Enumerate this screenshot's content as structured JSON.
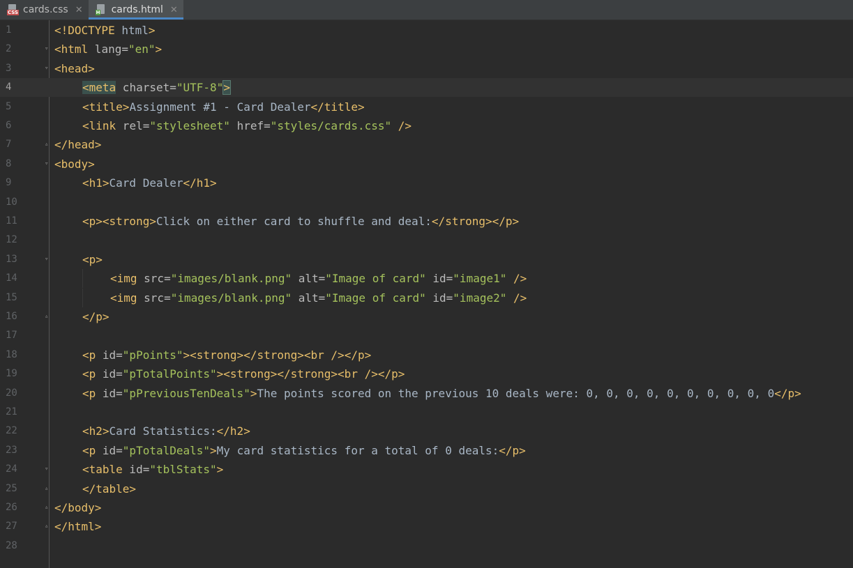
{
  "tabs": [
    {
      "label": "cards.css",
      "type": "css",
      "badge": "CSS",
      "active": false
    },
    {
      "label": "cards.html",
      "type": "html",
      "badge": "H",
      "active": true
    }
  ],
  "colors": {
    "tag": "#e8bf6a",
    "attr": "#bababa",
    "value": "#a5c25c",
    "text": "#a9b7c6",
    "background": "#2b2b2b",
    "accent": "#4a88c7"
  },
  "current_line": 4,
  "lines": [
    {
      "n": "1",
      "indent": 0,
      "fold": "",
      "seg": [
        [
          "tag",
          "<!DOCTYPE"
        ],
        [
          "text",
          " html"
        ],
        [
          "tag",
          ">"
        ]
      ]
    },
    {
      "n": "2",
      "indent": 0,
      "fold": "open",
      "seg": [
        [
          "tag",
          "<html"
        ],
        [
          "attr",
          " lang="
        ],
        [
          "val",
          "\"en\""
        ],
        [
          "tag",
          ">"
        ]
      ]
    },
    {
      "n": "3",
      "indent": 0,
      "fold": "open",
      "seg": [
        [
          "tag",
          "<head>"
        ]
      ]
    },
    {
      "n": "4",
      "indent": 1,
      "fold": "",
      "seg": [
        [
          "taghl",
          "<meta"
        ],
        [
          "attr",
          " charset="
        ],
        [
          "val",
          "\"UTF-8\""
        ],
        [
          "tagcaret",
          ">"
        ]
      ]
    },
    {
      "n": "5",
      "indent": 1,
      "fold": "",
      "seg": [
        [
          "tag",
          "<title>"
        ],
        [
          "text",
          "Assignment #1 - Card Dealer"
        ],
        [
          "tag",
          "</title>"
        ]
      ]
    },
    {
      "n": "6",
      "indent": 1,
      "fold": "",
      "seg": [
        [
          "tag",
          "<link"
        ],
        [
          "attr",
          " rel="
        ],
        [
          "val",
          "\"stylesheet\""
        ],
        [
          "attr",
          " href="
        ],
        [
          "val",
          "\"styles/cards.css\""
        ],
        [
          "tag",
          " />"
        ]
      ]
    },
    {
      "n": "7",
      "indent": 0,
      "fold": "close",
      "seg": [
        [
          "tag",
          "</head>"
        ]
      ]
    },
    {
      "n": "8",
      "indent": 0,
      "fold": "open",
      "seg": [
        [
          "tag",
          "<body>"
        ]
      ]
    },
    {
      "n": "9",
      "indent": 1,
      "fold": "",
      "seg": [
        [
          "tag",
          "<h1>"
        ],
        [
          "text",
          "Card Dealer"
        ],
        [
          "tag",
          "</h1>"
        ]
      ]
    },
    {
      "n": "10",
      "indent": 0,
      "fold": "",
      "seg": []
    },
    {
      "n": "11",
      "indent": 1,
      "fold": "",
      "seg": [
        [
          "tag",
          "<p><strong>"
        ],
        [
          "text",
          "Click on either card to shuffle and deal:"
        ],
        [
          "tag",
          "</strong></p>"
        ]
      ]
    },
    {
      "n": "12",
      "indent": 0,
      "fold": "",
      "seg": []
    },
    {
      "n": "13",
      "indent": 1,
      "fold": "open",
      "seg": [
        [
          "tag",
          "<p>"
        ]
      ]
    },
    {
      "n": "14",
      "indent": 2,
      "fold": "",
      "seg": [
        [
          "tag",
          "<img"
        ],
        [
          "attr",
          " src="
        ],
        [
          "val",
          "\"images/blank.png\""
        ],
        [
          "attr",
          " alt="
        ],
        [
          "val",
          "\"Image of card\""
        ],
        [
          "attr",
          " id="
        ],
        [
          "val",
          "\"image1\""
        ],
        [
          "tag",
          " />"
        ]
      ]
    },
    {
      "n": "15",
      "indent": 2,
      "fold": "",
      "seg": [
        [
          "tag",
          "<img"
        ],
        [
          "attr",
          " src="
        ],
        [
          "val",
          "\"images/blank.png\""
        ],
        [
          "attr",
          " alt="
        ],
        [
          "val",
          "\"Image of card\""
        ],
        [
          "attr",
          " id="
        ],
        [
          "val",
          "\"image2\""
        ],
        [
          "tag",
          " />"
        ]
      ]
    },
    {
      "n": "16",
      "indent": 1,
      "fold": "close",
      "seg": [
        [
          "tag",
          "</p>"
        ]
      ]
    },
    {
      "n": "17",
      "indent": 0,
      "fold": "",
      "seg": []
    },
    {
      "n": "18",
      "indent": 1,
      "fold": "",
      "seg": [
        [
          "tag",
          "<p"
        ],
        [
          "attr",
          " id="
        ],
        [
          "val",
          "\"pPoints\""
        ],
        [
          "tag",
          "><strong></strong><br /></p>"
        ]
      ]
    },
    {
      "n": "19",
      "indent": 1,
      "fold": "",
      "seg": [
        [
          "tag",
          "<p"
        ],
        [
          "attr",
          " id="
        ],
        [
          "val",
          "\"pTotalPoints\""
        ],
        [
          "tag",
          "><strong></strong><br /></p>"
        ]
      ]
    },
    {
      "n": "20",
      "indent": 1,
      "fold": "",
      "seg": [
        [
          "tag",
          "<p"
        ],
        [
          "attr",
          " id="
        ],
        [
          "val",
          "\"pPreviousTenDeals\""
        ],
        [
          "tag",
          ">"
        ],
        [
          "text",
          "The points scored on the previous 10 deals were: 0, 0, 0, 0, 0, 0, 0, 0, 0, 0"
        ],
        [
          "tag",
          "</p>"
        ]
      ]
    },
    {
      "n": "21",
      "indent": 0,
      "fold": "",
      "seg": []
    },
    {
      "n": "22",
      "indent": 1,
      "fold": "",
      "seg": [
        [
          "tag",
          "<h2>"
        ],
        [
          "text",
          "Card Statistics:"
        ],
        [
          "tag",
          "</h2>"
        ]
      ]
    },
    {
      "n": "23",
      "indent": 1,
      "fold": "",
      "seg": [
        [
          "tag",
          "<p"
        ],
        [
          "attr",
          " id="
        ],
        [
          "val",
          "\"pTotalDeals\""
        ],
        [
          "tag",
          ">"
        ],
        [
          "text",
          "My card statistics for a total of 0 deals:"
        ],
        [
          "tag",
          "</p>"
        ]
      ]
    },
    {
      "n": "24",
      "indent": 1,
      "fold": "open",
      "seg": [
        [
          "tag",
          "<table"
        ],
        [
          "attr",
          " id="
        ],
        [
          "val",
          "\"tblStats\""
        ],
        [
          "tag",
          ">"
        ]
      ]
    },
    {
      "n": "25",
      "indent": 1,
      "fold": "close",
      "seg": [
        [
          "tag",
          "</table>"
        ]
      ]
    },
    {
      "n": "26",
      "indent": 0,
      "fold": "close",
      "seg": [
        [
          "tag",
          "</body>"
        ]
      ]
    },
    {
      "n": "27",
      "indent": 0,
      "fold": "close",
      "seg": [
        [
          "tag",
          "</html>"
        ]
      ]
    },
    {
      "n": "28",
      "indent": 0,
      "fold": "",
      "seg": []
    }
  ]
}
